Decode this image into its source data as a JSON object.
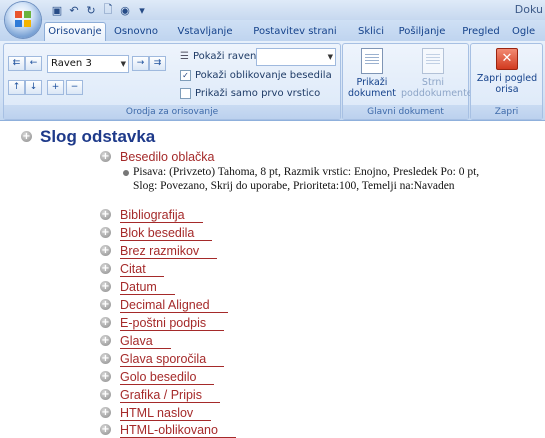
{
  "window": {
    "title": "Doku"
  },
  "tabs": [
    "Orisovanje",
    "Osnovno",
    "Vstavljanje",
    "Postavitev strani",
    "Sklici",
    "Pošiljanje",
    "Pregled",
    "Ogle"
  ],
  "ribbon": {
    "outline_tools": {
      "level_value": "Raven 3",
      "show_level_label": "Pokaži raven:",
      "show_text_formatting": "Pokaži oblikovanje besedila",
      "show_text_formatting_checked": true,
      "show_first_line": "Prikaži samo prvo vrstico",
      "show_first_line_checked": false,
      "group_label": "Orodja za orisovanje"
    },
    "master_document": {
      "show_document": "Prikaži dokument",
      "subdocuments": "Strni poddokumente",
      "group_label": "Glavni dokument"
    },
    "close": {
      "button": "Zapri pogled orisa",
      "group_label": "Zapri"
    }
  },
  "outline": {
    "heading": "Slog odstavka",
    "first_item": "Besedilo oblačka",
    "description": "Pisava: (Privzeto) Tahoma, 8 pt, Razmik vrstic:  Enojno, Presledek Po:  0 pt, Slog: Povezano, Skrij do uporabe, Prioriteta:100, Temelji na:Navaden",
    "items": [
      "Bibliografija",
      "Blok besedila",
      "Brez razmikov",
      "Citat",
      "Datum",
      "Decimal Aligned",
      "E-poštni podpis",
      "Glava",
      "Glava sporočila",
      "Golo besedilo",
      "Grafika / Pripis",
      "HTML naslov",
      "HTML-oblikovano"
    ]
  },
  "colors": {
    "heading": "#1e3a8a",
    "item": "#a52a2a",
    "ribbon": "#d3e2f5"
  }
}
